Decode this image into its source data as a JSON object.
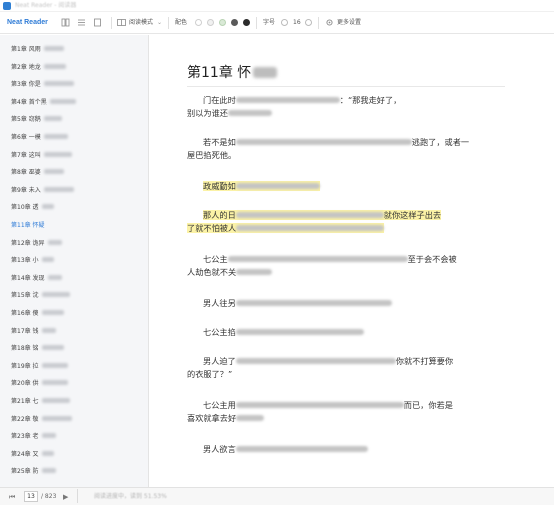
{
  "window": {
    "title": "Neat Reader - 阅读器"
  },
  "toolbar": {
    "brand": "Neat Reader",
    "reading_mode_label": "阅读模式",
    "color_label": "配色",
    "font_size_label": "字号",
    "font_size_value": "16",
    "more_settings_label": "更多设置",
    "swatches": [
      "#ffffff",
      "#f1f1f1",
      "#d9e9d6",
      "#5a5a5a",
      "#2b2b2b"
    ]
  },
  "sidebar": {
    "items": [
      {
        "label": "第1章 风雨",
        "blur_w": 20
      },
      {
        "label": "第2章 地龙",
        "blur_w": 22
      },
      {
        "label": "第3章 你是",
        "blur_w": 30
      },
      {
        "label": "第4章 首个黑",
        "blur_w": 26
      },
      {
        "label": "第5章 窃鹅",
        "blur_w": 18
      },
      {
        "label": "第6章 一模",
        "blur_w": 24
      },
      {
        "label": "第7章 这叫",
        "blur_w": 28
      },
      {
        "label": "第8章 巫婆",
        "blur_w": 20
      },
      {
        "label": "第9章 未入",
        "blur_w": 30
      },
      {
        "label": "第10章 透",
        "blur_w": 12
      },
      {
        "label": "第11章 怀疑",
        "blur_w": 0,
        "active": true
      },
      {
        "label": "第12章 诡异",
        "blur_w": 14
      },
      {
        "label": "第13章 小",
        "blur_w": 12
      },
      {
        "label": "第14章 发现",
        "blur_w": 14
      },
      {
        "label": "第15章 沈",
        "blur_w": 28
      },
      {
        "label": "第16章 傻",
        "blur_w": 22
      },
      {
        "label": "第17章 钱",
        "blur_w": 14
      },
      {
        "label": "第18章 铭",
        "blur_w": 22
      },
      {
        "label": "第19章 拉",
        "blur_w": 26
      },
      {
        "label": "第20章 供",
        "blur_w": 26
      },
      {
        "label": "第21章 七",
        "blur_w": 28
      },
      {
        "label": "第22章 敬",
        "blur_w": 30
      },
      {
        "label": "第23章 老",
        "blur_w": 14
      },
      {
        "label": "第24章 又",
        "blur_w": 12
      },
      {
        "label": "第25章 防",
        "blur_w": 14
      }
    ]
  },
  "chapter": {
    "title": "第11章 怀疑",
    "title_visible": "第11章 怀",
    "paragraphs": [
      {
        "segs": [
          {
            "t": "门在此时"
          },
          {
            "b": 104
          },
          {
            "t": "：“那我走好了，"
          },
          {
            "br": 1
          },
          {
            "t": "别以为谁还"
          },
          {
            "b": 44
          }
        ]
      },
      {
        "segs": [
          {
            "t": "若不是如"
          },
          {
            "b": 176
          },
          {
            "t": "逃跑了，或者一"
          },
          {
            "br": 1
          },
          {
            "t": "屋巴掐死他。"
          }
        ]
      },
      {
        "hl": true,
        "segs": [
          {
            "t": "政威勤如"
          },
          {
            "b": 84
          }
        ]
      },
      {
        "hl": true,
        "segs": [
          {
            "t": "那人的日"
          },
          {
            "b": 148
          },
          {
            "t": "就你这样子出去"
          },
          {
            "br": 1
          },
          {
            "t": "了就不怕被人"
          },
          {
            "b": 148
          }
        ]
      },
      {
        "segs": [
          {
            "t": "七公主"
          },
          {
            "b": 180
          },
          {
            "t": "至于会不会被"
          },
          {
            "br": 1
          },
          {
            "t": "人劫色就不关"
          },
          {
            "b": 36
          }
        ]
      },
      {
        "segs": [
          {
            "t": "男人往另"
          },
          {
            "b": 156
          }
        ]
      },
      {
        "segs": [
          {
            "t": "七公主掐"
          },
          {
            "b": 128
          }
        ]
      },
      {
        "segs": [
          {
            "t": "男人迫了"
          },
          {
            "b": 160
          },
          {
            "t": "你就不打算要你"
          },
          {
            "br": 1
          },
          {
            "t": "的衣服了？”"
          }
        ]
      },
      {
        "segs": [
          {
            "t": "七公主用"
          },
          {
            "b": 168
          },
          {
            "t": "而已，你若是"
          },
          {
            "br": 1
          },
          {
            "t": "喜欢就拿去好"
          },
          {
            "b": 28
          }
        ]
      },
      {
        "segs": [
          {
            "t": "男人欲言"
          },
          {
            "b": 132
          }
        ]
      }
    ]
  },
  "status": {
    "first_label": "⏮",
    "prev_label": "◀",
    "page_current": "13",
    "page_total": "/ 823",
    "next_label": "▶",
    "last_label": "⏭",
    "progress": "阅读进度中，读到 51.53%"
  }
}
